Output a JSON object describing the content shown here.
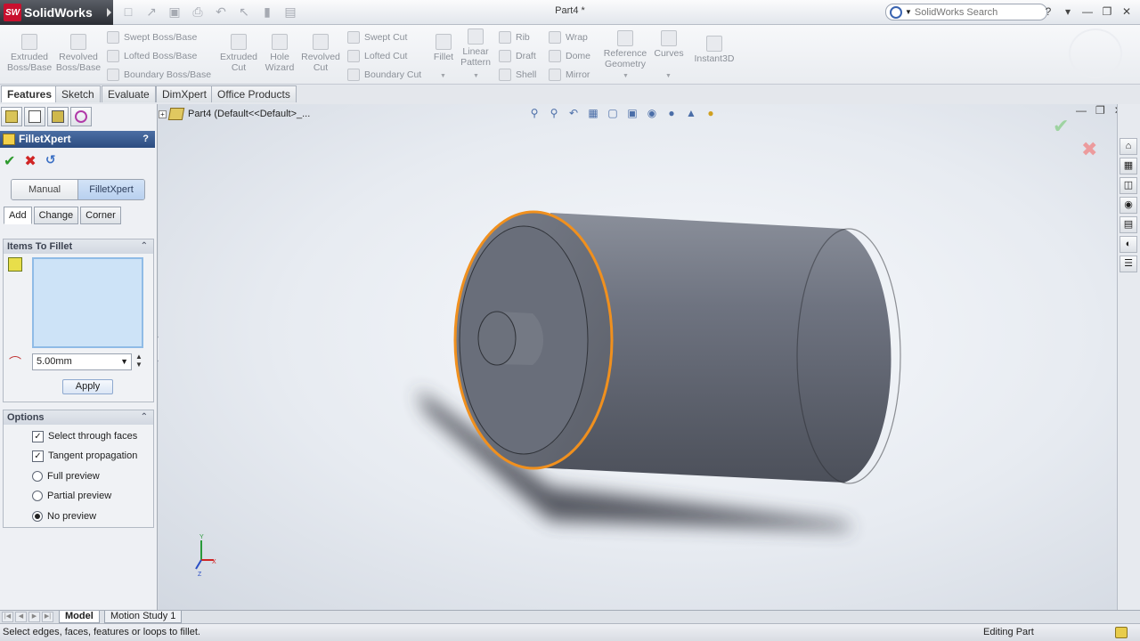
{
  "app": {
    "name": "SolidWorks",
    "logo_mark": "SW",
    "doc_title": "Part4 *"
  },
  "search": {
    "placeholder": "SolidWorks Search"
  },
  "command_manager": {
    "big_buttons": [
      {
        "label": "Extruded\nBoss/Base"
      },
      {
        "label": "Revolved\nBoss/Base"
      },
      {
        "label": "Extruded\nCut"
      },
      {
        "label": "Hole\nWizard"
      },
      {
        "label": "Revolved\nCut"
      },
      {
        "label": "Fillet"
      },
      {
        "label": "Linear\nPattern"
      },
      {
        "label": "Reference\nGeometry"
      },
      {
        "label": "Curves"
      },
      {
        "label": "Instant3D"
      }
    ],
    "small_buttons": [
      {
        "label": "Swept Boss/Base"
      },
      {
        "label": "Lofted Boss/Base"
      },
      {
        "label": "Boundary Boss/Base"
      },
      {
        "label": "Swept Cut"
      },
      {
        "label": "Lofted Cut"
      },
      {
        "label": "Boundary Cut"
      },
      {
        "label": "Rib"
      },
      {
        "label": "Draft"
      },
      {
        "label": "Shell"
      },
      {
        "label": "Wrap"
      },
      {
        "label": "Dome"
      },
      {
        "label": "Mirror"
      }
    ]
  },
  "tabs": [
    {
      "label": "Features",
      "active": true
    },
    {
      "label": "Sketch"
    },
    {
      "label": "Evaluate"
    },
    {
      "label": "DimXpert"
    },
    {
      "label": "Office Products"
    }
  ],
  "property_manager": {
    "title": "FilletXpert",
    "help": "?",
    "modes": [
      "Manual",
      "FilletXpert"
    ],
    "subtabs": [
      "Add",
      "Change",
      "Corner"
    ],
    "items_group": {
      "title": "Items To Fillet",
      "radius_value": "5.00mm",
      "apply_label": "Apply"
    },
    "options_group": {
      "title": "Options",
      "options": [
        {
          "label": "Select through faces",
          "type": "checkbox",
          "checked": true
        },
        {
          "label": "Tangent propagation",
          "type": "checkbox",
          "checked": true
        },
        {
          "label": "Full preview",
          "type": "radio",
          "checked": false
        },
        {
          "label": "Partial preview",
          "type": "radio",
          "checked": false
        },
        {
          "label": "No preview",
          "type": "radio",
          "checked": true
        }
      ]
    }
  },
  "graphics": {
    "tree_root": "Part4  (Default<<Default>_...",
    "highlight_color": "#f0901e"
  },
  "bottom_tabs": [
    "Model",
    "Motion Study 1"
  ],
  "status": {
    "message": "Select edges, faces, features or loops to fillet.",
    "mode": "Editing Part"
  }
}
